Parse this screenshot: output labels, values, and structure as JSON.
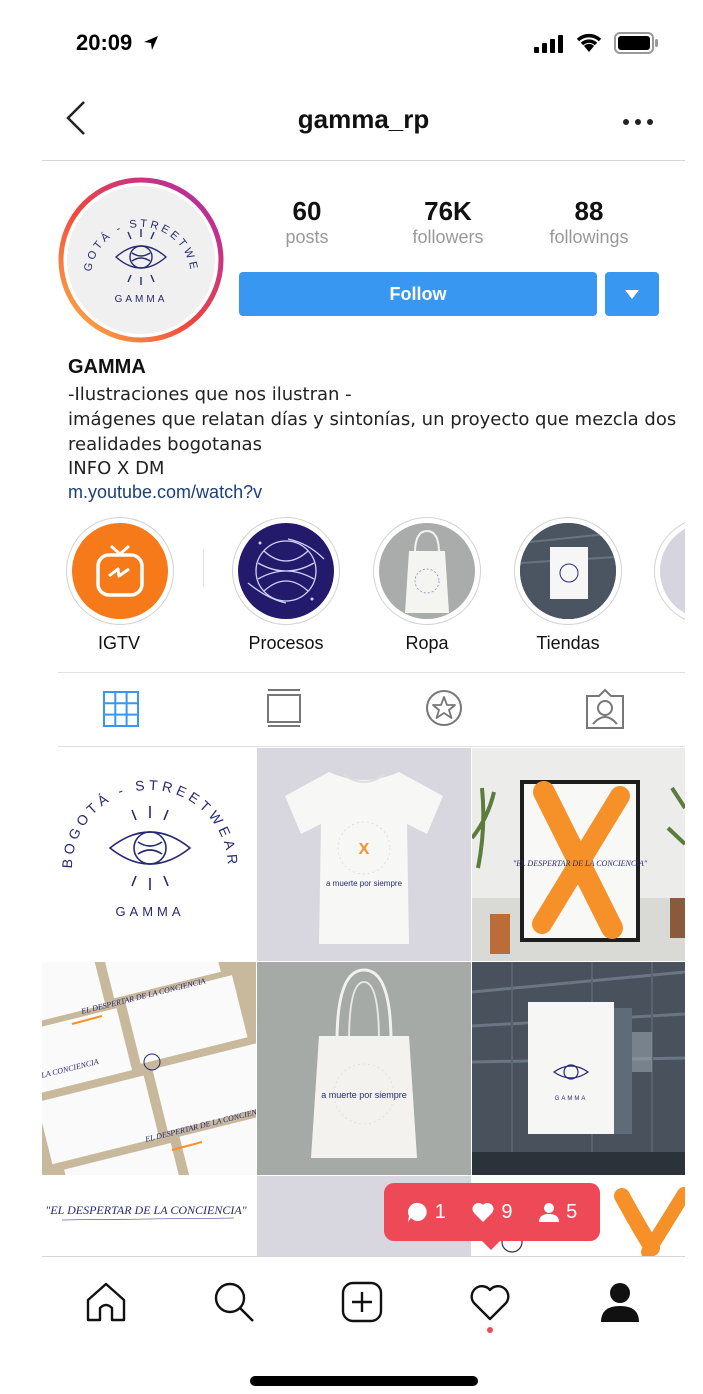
{
  "status_bar": {
    "time": "20:09"
  },
  "nav": {
    "title": "gamma_rp"
  },
  "profile": {
    "logo_text": {
      "top": "BOGOTÁ - STREETWEAR",
      "bottom": "GAMMA"
    },
    "stats": [
      {
        "value": "60",
        "label": "posts"
      },
      {
        "value": "76K",
        "label": "followers"
      },
      {
        "value": "88",
        "label": "followings"
      }
    ],
    "follow_label": "Follow",
    "name": "GAMMA",
    "bio": [
      "-Ilustraciones que nos ilustran -",
      "imágenes que relatan días y sintonías, un proyecto que mezcla dos",
      "realidades bogotanas",
      "INFO X DM"
    ],
    "link": "m.youtube.com/watch?v"
  },
  "highlights": [
    {
      "label": "IGTV"
    },
    {
      "label": "Procesos"
    },
    {
      "label": "Ropa"
    },
    {
      "label": "Tiendas"
    }
  ],
  "posts": {
    "tile_texts": {
      "logo_top": "BOGOTÁ - STREETWEAR",
      "logo_bottom": "GAMMA",
      "shirt_text": "a muerte por siempre",
      "shirt_x": "X",
      "poster_caption": "\"EL DESPERTAR DE LA CONCIENCIA\"",
      "card_title": "EL DESPERTAR DE LA CONCIENCIA",
      "card_title_short": "LA CONCIENCIA",
      "bag_text": "a muerte por siempre",
      "bottom_caption": "\"EL DESPERTAR DE LA CONCIENCIA\""
    }
  },
  "notification": {
    "comments": "1",
    "likes": "9",
    "follows": "5"
  },
  "colors": {
    "accent": "#3897f0",
    "notification": "#ed4956",
    "igtv": "#f77a1a",
    "brand_navy": "#262a72",
    "orange_x": "#f6912a"
  }
}
